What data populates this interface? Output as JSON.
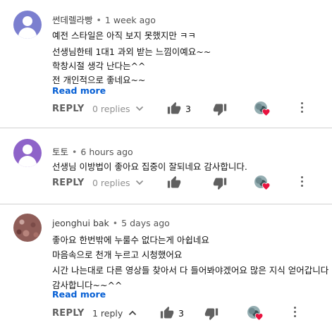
{
  "comments": [
    {
      "author": "썬데렐라빵",
      "time": "1 week ago",
      "lines": [
        "예전 스타일은 아직 보지 못했지만 ㅋㅋ",
        "선생님한테 1대1 과외 받는 느낌이예요~~",
        "학창시절 생각 난다는^^",
        "전 개인적으로 좋네요~~"
      ],
      "read_more": "Read more",
      "reply_label": "REPLY",
      "replies": "0 replies",
      "likes": "3"
    },
    {
      "author": "토토",
      "time": "6 hours ago",
      "lines": [
        "선생님 이방법이  좋아요 집중이 잘되네요 감사합니다."
      ],
      "reply_label": "REPLY",
      "replies": "0 replies",
      "likes": ""
    },
    {
      "author": "jeonghui bak",
      "time": "5 days ago",
      "lines": [
        "좋아요 한번밖에 누룰수 없다는게 아쉽네요",
        "마음속으로 천개 누르고 시청했어요",
        "시간 나는대로 다른 영상들 찾아서 다 들어봐야겠어요 많은 지식 얻어갑니다",
        "감사합니다~~^^"
      ],
      "read_more": "Read more",
      "reply_label": "REPLY",
      "replies": "1 reply",
      "likes": "3"
    }
  ],
  "separator": "•",
  "colors": {
    "link": "#065fd4",
    "heart": "#e8133f",
    "avatar_1": "#7b7fcf",
    "avatar_2": "#8e63c9"
  },
  "icons": {
    "like": "thumb-up-icon",
    "dislike": "thumb-down-icon",
    "expand": "chevron-down-icon",
    "collapse": "chevron-up-icon",
    "creator_heart": "heart-icon",
    "more": "more-vert-icon"
  }
}
